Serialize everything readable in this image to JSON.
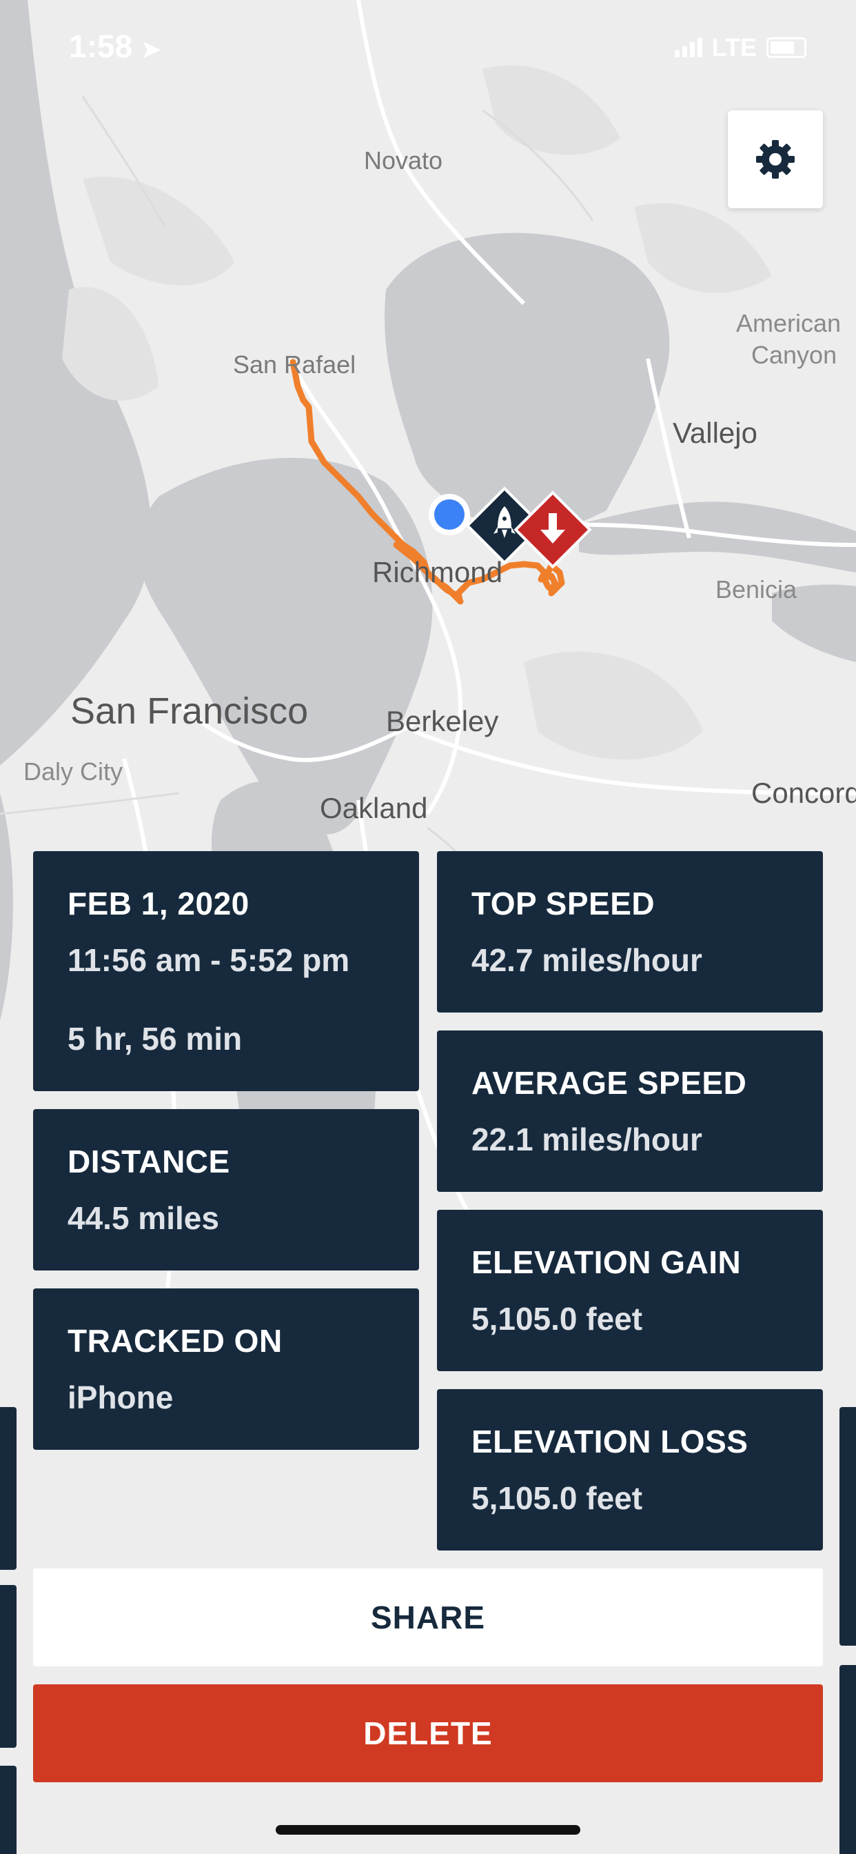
{
  "status_bar": {
    "time": "1:58",
    "network": "LTE"
  },
  "map": {
    "labels": {
      "novato": "Novato",
      "san_rafael": "San Rafael",
      "american_canyon_1": "American",
      "american_canyon_2": "Canyon",
      "vallejo": "Vallejo",
      "richmond": "Richmond",
      "benicia": "Benicia",
      "san_francisco": "San Francisco",
      "berkeley": "Berkeley",
      "daly_city": "Daly City",
      "oakland": "Oakland",
      "concord": "Concord"
    },
    "route_color": "#f07f2c",
    "start_icon": "rocket-icon",
    "end_icon": "arrow-down-icon"
  },
  "settings": {
    "icon": "gear-icon"
  },
  "cards": {
    "date": {
      "heading": "FEB 1, 2020",
      "time_range": "11:56 am - 5:52 pm",
      "duration": "5 hr, 56 min"
    },
    "distance": {
      "heading": "DISTANCE",
      "value": "44.5 miles"
    },
    "tracked_on": {
      "heading": "TRACKED ON",
      "value": "iPhone"
    },
    "top_speed": {
      "heading": "TOP SPEED",
      "value": "42.7 miles/hour"
    },
    "average_speed": {
      "heading": "AVERAGE SPEED",
      "value": "22.1 miles/hour"
    },
    "elevation_gain": {
      "heading": "ELEVATION GAIN",
      "value": "5,105.0 feet"
    },
    "elevation_loss": {
      "heading": "ELEVATION LOSS",
      "value": "5,105.0 feet"
    }
  },
  "actions": {
    "share": "SHARE",
    "delete": "DELETE"
  },
  "colors": {
    "card_bg": "#172a3d",
    "delete_bg": "#d03a22",
    "accent_blue": "#3b82f6"
  }
}
